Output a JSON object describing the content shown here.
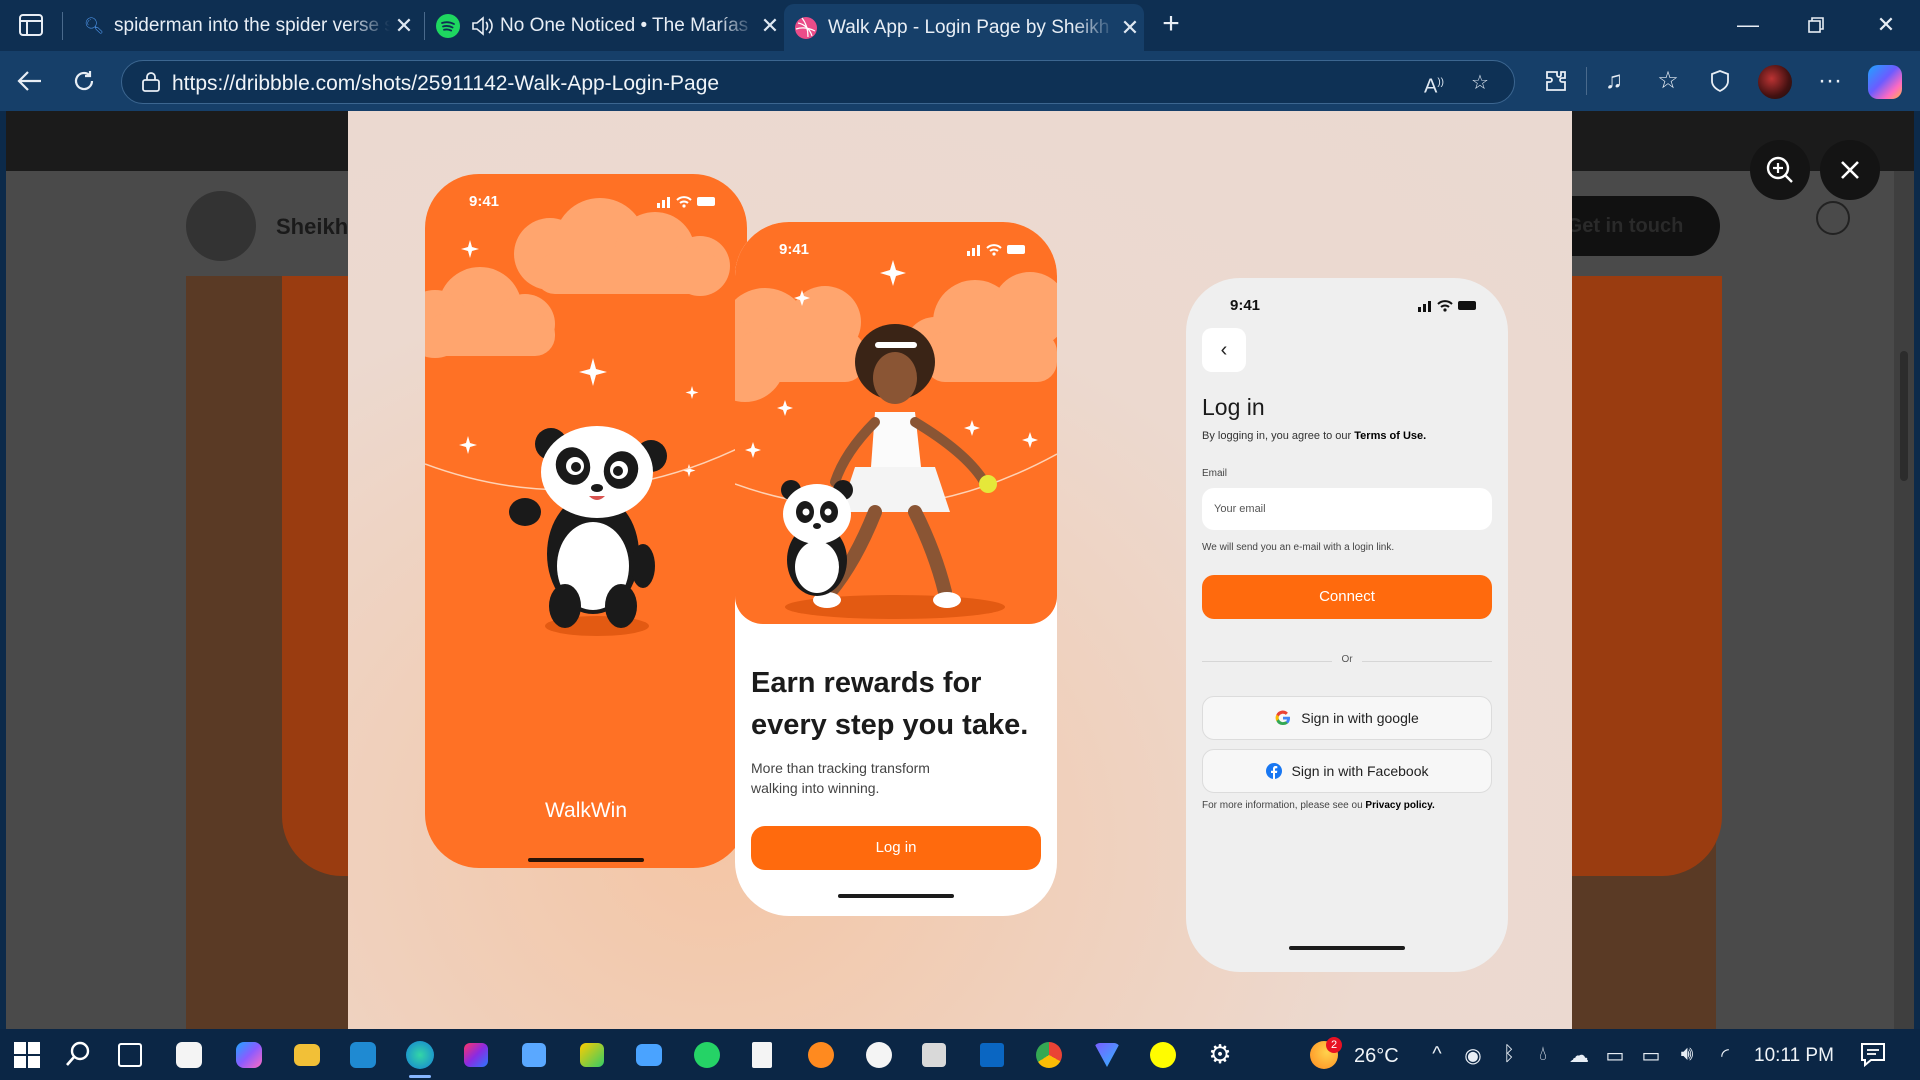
{
  "browser": {
    "tabs": [
      {
        "label": "spiderman into the spider verse s"
      },
      {
        "label": "No One Noticed • The Marías"
      },
      {
        "label": "Walk App - Login Page by Sheikh"
      }
    ],
    "url": "https://dribbble.com/shots/25911142-Walk-App-Login-Page"
  },
  "page": {
    "author_name": "Sheikh",
    "get_in_touch": "Get in touch"
  },
  "shot": {
    "phone1": {
      "time": "9:41",
      "brand": "WalkWin"
    },
    "phone2": {
      "time": "9:41",
      "headline": "Earn rewards for every step you take.",
      "subtext": "More than tracking transform walking  into winning.",
      "login_button": "Log in"
    },
    "phone3": {
      "time": "9:41",
      "back": "‹",
      "title": "Log in",
      "agree_prefix": "By logging in, you agree to our ",
      "agree_link": "Terms of Use.",
      "email_label": "Email",
      "email_placeholder": "Your email",
      "email_hint": "We will send you an e-mail with a login link.",
      "connect_button": "Connect",
      "or_label": "Or",
      "google_button": "Sign in with google",
      "facebook_button": "Sign in with Facebook",
      "policy_prefix": "For more information, please see ou ",
      "policy_link": "Privacy policy."
    }
  },
  "taskbar": {
    "weather_temp": "26°C",
    "weather_badge": "2",
    "clock": "10:11 PM"
  },
  "colors": {
    "accent_orange": "#ff6a0d",
    "browser_chrome": "#0e2f52"
  }
}
